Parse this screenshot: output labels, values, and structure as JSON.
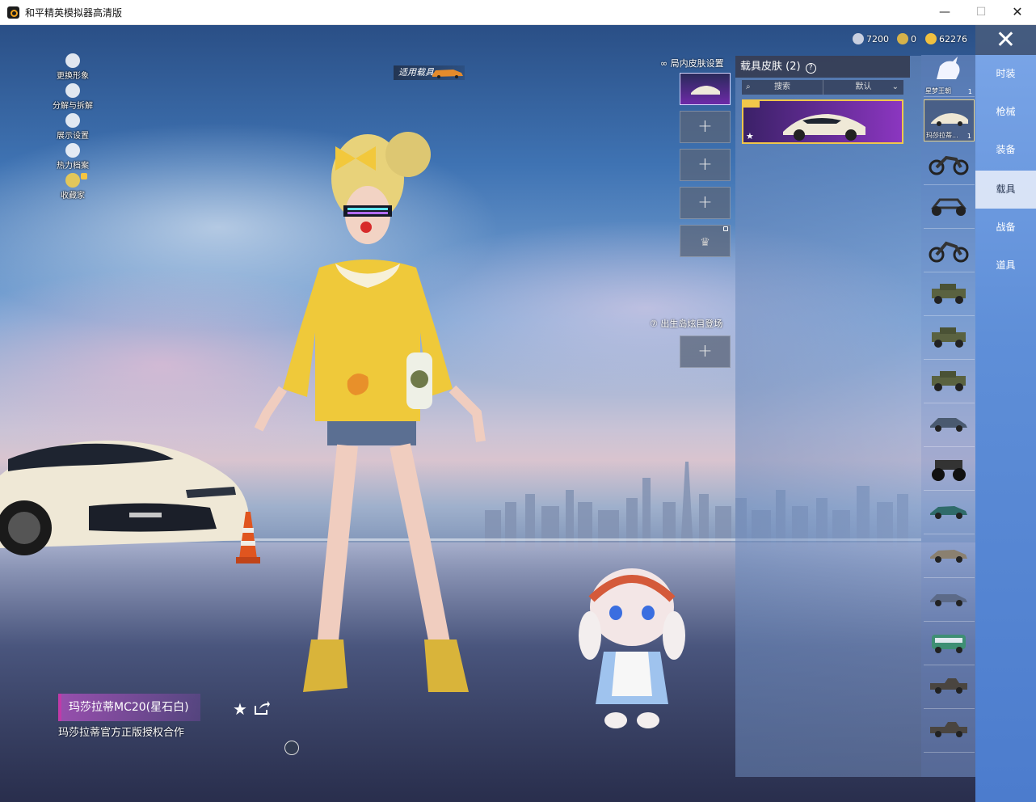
{
  "window": {
    "title": "和平精英模拟器高清版",
    "min_label": "—",
    "max_label": "☐",
    "close_label": "✕"
  },
  "left_menu": [
    {
      "label": "更换形象",
      "icon": "user-icon"
    },
    {
      "label": "分解与拆解",
      "icon": "puzzle-icon"
    },
    {
      "label": "展示设置",
      "icon": "eye-icon"
    },
    {
      "label": "热力档案",
      "icon": "flame-icon"
    },
    {
      "label": "收藏家",
      "icon": "collector-badge-icon"
    }
  ],
  "apply_vehicle_label": "适用载具",
  "currency": [
    {
      "value": "7200",
      "color": "#c8cfe0"
    },
    {
      "value": "0",
      "color": "#d6b24a"
    },
    {
      "value": "62276",
      "color": "#f0c040"
    }
  ],
  "slots": {
    "in_match_label": "局内皮肤设置",
    "spawn_label": "出生岛炫目登场",
    "add_symbol": "+"
  },
  "skin_panel": {
    "title": "载具皮肤 (2)",
    "help": "?",
    "search_label": "搜索",
    "sort_label": "默认"
  },
  "vehicle_list": {
    "item1_label": "星梦王朝",
    "item1_count": "1",
    "item2_label": "玛莎拉蒂...",
    "item2_count": "1"
  },
  "categories": [
    {
      "label": "时装"
    },
    {
      "label": "枪械"
    },
    {
      "label": "装备"
    },
    {
      "label": "载具",
      "active": true
    },
    {
      "label": "战备"
    },
    {
      "label": "道具"
    }
  ],
  "close_label": "✕",
  "info": {
    "name": "玛莎拉蒂MC20(星石白)",
    "desc": "玛莎拉蒂官方正版授权合作"
  },
  "colors": {
    "accent_gold": "#f1c74a",
    "tab_blue": "#5f8fd8",
    "name_purple": "#c03aa8"
  }
}
